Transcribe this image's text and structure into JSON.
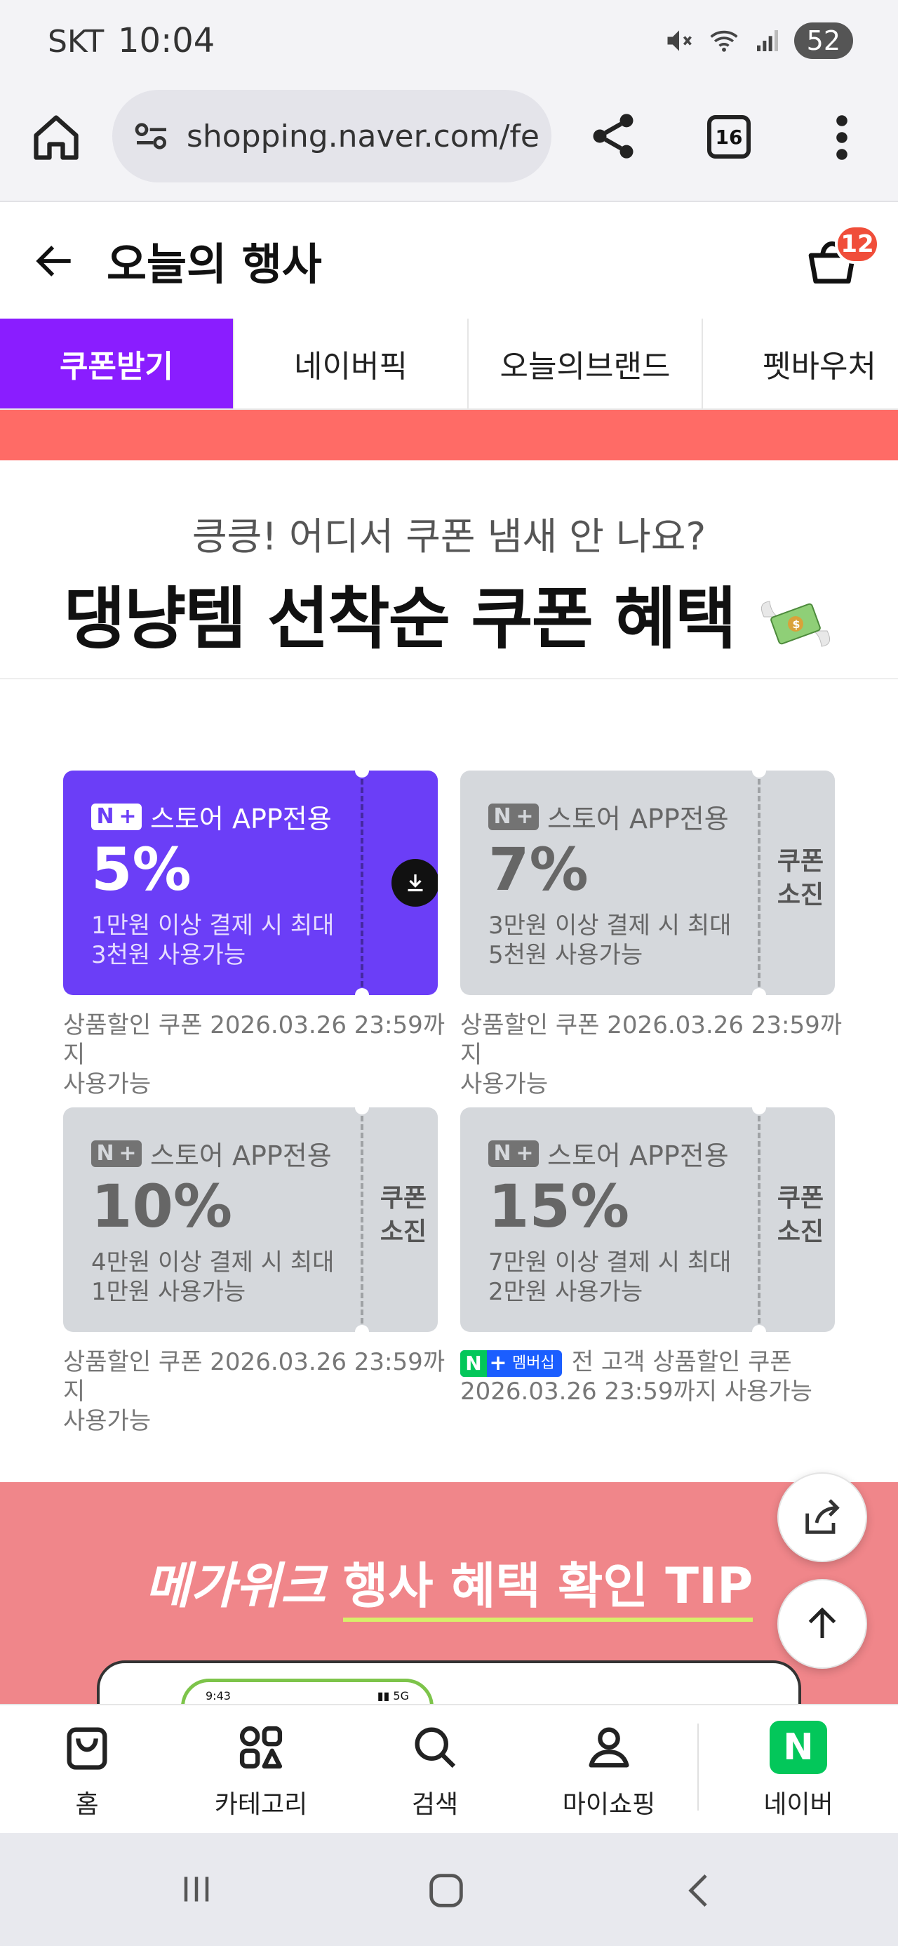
{
  "status_bar": {
    "carrier": "SKT",
    "time": "10:04",
    "battery": "52"
  },
  "browser": {
    "url": "shopping.naver.com/fe",
    "tab_count": "16"
  },
  "header": {
    "title": "오늘의 행사",
    "cart_count": "12"
  },
  "tabs": [
    {
      "label": "쿠폰받기",
      "active": true
    },
    {
      "label": "네이버픽",
      "active": false
    },
    {
      "label": "오늘의브랜드",
      "active": false
    },
    {
      "label": "펫바우처",
      "active": false
    }
  ],
  "hero": {
    "subtitle": "킁킁! 어디서 쿠폰 냄새 안 나요?",
    "title": "댕냥템 선착순 쿠폰 혜택"
  },
  "coupons": [
    {
      "brand": "스토어 APP전용",
      "rate": "5%",
      "cond1": "1만원 이상 결제 시 최대",
      "cond2": "3천원 사용가능",
      "status": "download",
      "note1": "상품할인 쿠폰 2026.03.26 23:59까지",
      "note2": "사용가능"
    },
    {
      "brand": "스토어 APP전용",
      "rate": "7%",
      "cond1": "3만원 이상 결제 시 최대",
      "cond2": "5천원 사용가능",
      "status": "쿠폰 소진",
      "soldout1": "쿠폰",
      "soldout2": "소진",
      "note1": "상품할인 쿠폰 2026.03.26 23:59까지",
      "note2": "사용가능"
    },
    {
      "brand": "스토어 APP전용",
      "rate": "10%",
      "cond1": "4만원 이상 결제 시 최대",
      "cond2": "1만원 사용가능",
      "status": "쿠폰 소진",
      "soldout1": "쿠폰",
      "soldout2": "소진",
      "note1": "상품할인 쿠폰 2026.03.26 23:59까지",
      "note2": "사용가능"
    },
    {
      "brand": "스토어 APP전용",
      "rate": "15%",
      "cond1": "7만원 이상 결제 시 최대",
      "cond2": "2만원 사용가능",
      "status": "쿠폰 소진",
      "soldout1": "쿠폰",
      "soldout2": "소진",
      "member_badge": "멤버십",
      "note1": "전 고객 상품할인 쿠폰",
      "note2": "2026.03.26 23:59까지 사용가능"
    }
  ],
  "tip_section": {
    "title_em": "메가위크",
    "title_rest": "행사 혜택 확인 TIP",
    "phone_time": "9:43"
  },
  "bottom_nav": [
    {
      "label": "홈",
      "icon": "shopping-bag-icon"
    },
    {
      "label": "카테고리",
      "icon": "category-grid-icon"
    },
    {
      "label": "검색",
      "icon": "search-icon"
    },
    {
      "label": "마이쇼핑",
      "icon": "person-icon"
    },
    {
      "label": "네이버",
      "icon": "naver-logo-icon"
    }
  ],
  "colors": {
    "accent_purple": "#8a1dff",
    "coupon_purple": "#6b3ef7",
    "red_band": "#ff6b66",
    "pink_section": "#f0868a",
    "naver_green": "#03c75a"
  }
}
